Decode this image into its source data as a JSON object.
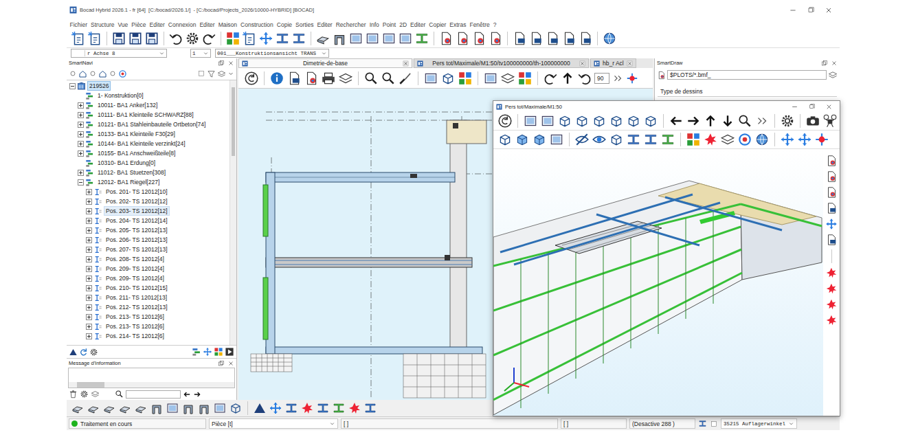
{
  "window": {
    "title": "Bocad Hybrid 2026.1 - fr [64]  [C:/bocad/2026.1/]  - [C:/bocad/Projects_2026/10000-HYBRID] [BOCAD]"
  },
  "menu": [
    "Fichier",
    "Structure",
    "Vue",
    "Pièce",
    "Editer",
    "Connexion",
    "Editer",
    "Maison",
    "Construction",
    "Copie",
    "Sorties",
    "Editer",
    "Rechercher",
    "Info",
    "Point",
    "2D",
    "Editer",
    "Copier",
    "Extras",
    "Fenêtre",
    "?"
  ],
  "selectors": {
    "axis": "r Achse 8",
    "level": "1",
    "view": "001___Konstruktionsansicht TRANS"
  },
  "smartnavi": {
    "title": "SmartNavi",
    "tree": [
      {
        "label": "219526",
        "depth": 0,
        "kind": "root",
        "expandable": true,
        "expanded": true,
        "selected": true,
        "highlighted": false
      },
      {
        "label": "1- Konstruktion[0]",
        "depth": 1,
        "kind": "group",
        "expandable": false,
        "expanded": false,
        "selected": false,
        "highlighted": false
      },
      {
        "label": "10011- BA1 Anker[132]",
        "depth": 1,
        "kind": "group",
        "expandable": true,
        "expanded": false,
        "selected": false,
        "highlighted": false
      },
      {
        "label": "10111- BA1 Kleinteile SCHWARZ[88]",
        "depth": 1,
        "kind": "group",
        "expandable": true,
        "expanded": false,
        "selected": false,
        "highlighted": false
      },
      {
        "label": "10121- BA1 Stahleinbauteile Ortbeton[74]",
        "depth": 1,
        "kind": "group",
        "expandable": true,
        "expanded": false,
        "selected": false,
        "highlighted": false
      },
      {
        "label": "10133- BA1 Kleinteile F30[29]",
        "depth": 1,
        "kind": "group",
        "expandable": true,
        "expanded": false,
        "selected": false,
        "highlighted": false
      },
      {
        "label": "10144- BA1 Kleinteile verzinkt[24]",
        "depth": 1,
        "kind": "group",
        "expandable": true,
        "expanded": false,
        "selected": false,
        "highlighted": false
      },
      {
        "label": "10155- BA1 Anschweißteile[8]",
        "depth": 1,
        "kind": "group",
        "expandable": true,
        "expanded": false,
        "selected": false,
        "highlighted": false
      },
      {
        "label": "10310- BA1 Erdung[0]",
        "depth": 1,
        "kind": "group",
        "expandable": false,
        "expanded": false,
        "selected": false,
        "highlighted": false
      },
      {
        "label": "11012- BA1 Stuetzen[308]",
        "depth": 1,
        "kind": "group",
        "expandable": true,
        "expanded": false,
        "selected": false,
        "highlighted": false
      },
      {
        "label": "12012- BA1 Riegel[227]",
        "depth": 1,
        "kind": "group",
        "expandable": true,
        "expanded": true,
        "selected": false,
        "highlighted": false
      },
      {
        "label": "Pos. 201- TS 12012[10]",
        "depth": 2,
        "kind": "position",
        "expandable": true,
        "expanded": false,
        "selected": false,
        "highlighted": false
      },
      {
        "label": "Pos. 202- TS 12012[12]",
        "depth": 2,
        "kind": "position",
        "expandable": true,
        "expanded": false,
        "selected": false,
        "highlighted": false
      },
      {
        "label": "Pos. 203- TS 12012[12]",
        "depth": 2,
        "kind": "position",
        "expandable": true,
        "expanded": false,
        "selected": false,
        "highlighted": true
      },
      {
        "label": "Pos. 204- TS 12012[14]",
        "depth": 2,
        "kind": "position",
        "expandable": true,
        "expanded": false,
        "selected": false,
        "highlighted": false
      },
      {
        "label": "Pos. 205- TS 12012[13]",
        "depth": 2,
        "kind": "position",
        "expandable": true,
        "expanded": false,
        "selected": false,
        "highlighted": false
      },
      {
        "label": "Pos. 206- TS 12012[13]",
        "depth": 2,
        "kind": "position",
        "expandable": true,
        "expanded": false,
        "selected": false,
        "highlighted": false
      },
      {
        "label": "Pos. 207- TS 12012[13]",
        "depth": 2,
        "kind": "position",
        "expandable": true,
        "expanded": false,
        "selected": false,
        "highlighted": false
      },
      {
        "label": "Pos. 208- TS 12012[4]",
        "depth": 2,
        "kind": "position",
        "expandable": true,
        "expanded": false,
        "selected": false,
        "highlighted": false
      },
      {
        "label": "Pos. 209- TS 12012[4]",
        "depth": 2,
        "kind": "position",
        "expandable": true,
        "expanded": false,
        "selected": false,
        "highlighted": false
      },
      {
        "label": "Pos. 209- TS 12012[4]",
        "depth": 2,
        "kind": "position",
        "expandable": true,
        "expanded": false,
        "selected": false,
        "highlighted": false
      },
      {
        "label": "Pos. 210- TS 12012[15]",
        "depth": 2,
        "kind": "position",
        "expandable": true,
        "expanded": false,
        "selected": false,
        "highlighted": false
      },
      {
        "label": "Pos. 211- TS 12012[13]",
        "depth": 2,
        "kind": "position",
        "expandable": true,
        "expanded": false,
        "selected": false,
        "highlighted": false
      },
      {
        "label": "Pos. 212- TS 12012[13]",
        "depth": 2,
        "kind": "position",
        "expandable": true,
        "expanded": false,
        "selected": false,
        "highlighted": false
      },
      {
        "label": "Pos. 213- TS 12012[6]",
        "depth": 2,
        "kind": "position",
        "expandable": true,
        "expanded": false,
        "selected": false,
        "highlighted": false
      },
      {
        "label": "Pos. 213- TS 12012[6]",
        "depth": 2,
        "kind": "position",
        "expandable": true,
        "expanded": false,
        "selected": false,
        "highlighted": false
      },
      {
        "label": "Pos. 214- TS 12012[6]",
        "depth": 2,
        "kind": "position",
        "expandable": true,
        "expanded": false,
        "selected": false,
        "highlighted": false
      }
    ]
  },
  "message_panel": {
    "title": "Message d'Information"
  },
  "view_tabs": [
    {
      "label": "Dimetrie-de-base",
      "selected": true
    },
    {
      "label": "Pers tot/Maximale/M1:50/tv100000000/th-100000000",
      "selected": false
    },
    {
      "label": "hb_r Acl",
      "selected": false
    }
  ],
  "view_toolbar": {
    "angle": "90"
  },
  "smartdraw": {
    "title": "SmartDraw",
    "filter": "$PLOTS/*.bmf_",
    "group": "Type de dessins"
  },
  "float_window": {
    "title": "Pers tot/Maximale/M1:50"
  },
  "status_bar": {
    "state": "Traitement en cours",
    "mode": "Pièce [t]",
    "field1": "[ ]",
    "field2": "[ ]",
    "deactivated": "(Desactive 288 )",
    "profile": "35215 Auflagerwinkel"
  }
}
